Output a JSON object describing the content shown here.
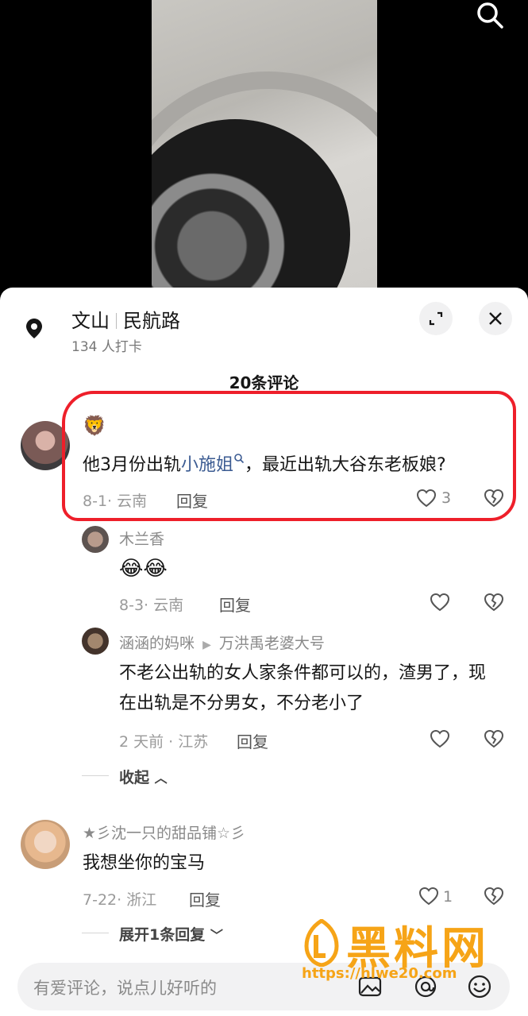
{
  "location": {
    "city": "文山",
    "place": "民航路",
    "checkins": "134 人打卡"
  },
  "comments_count": "20条评论",
  "comments": [
    {
      "name_emoji": "🦁",
      "text_before": "他3月份出轨",
      "link": "小施姐",
      "text_after": "，最近出轨大谷东老板娘?",
      "meta": "8-1· 云南",
      "reply": "回复",
      "likes": "3",
      "replies": [
        {
          "name": "木兰香",
          "text": "😂😂",
          "meta": "8-3· 云南",
          "reply": "回复"
        },
        {
          "name": "涵涵的妈咪",
          "reply_to": "万洪禹老婆大号",
          "text": "不老公出轨的女人家条件都可以的，渣男了，现在出轨是不分男女，不分老小了",
          "meta": "2 天前 · 江苏",
          "reply": "回复"
        }
      ],
      "collapse": "收起"
    },
    {
      "name": "★彡沈一只的甜品铺☆彡",
      "text": "我想坐你的宝马",
      "meta": "7-22· 浙江",
      "reply": "回复",
      "likes": "1",
      "expand": "展开1条回复"
    }
  ],
  "input": {
    "placeholder": "有爱评论，说点儿好听的"
  },
  "watermark": {
    "title": "黑料网",
    "url": "https://hlwe20.com"
  },
  "colors": {
    "accent_red": "#ee1f2a",
    "link": "#3b5b92",
    "watermark": "#f6a417"
  }
}
